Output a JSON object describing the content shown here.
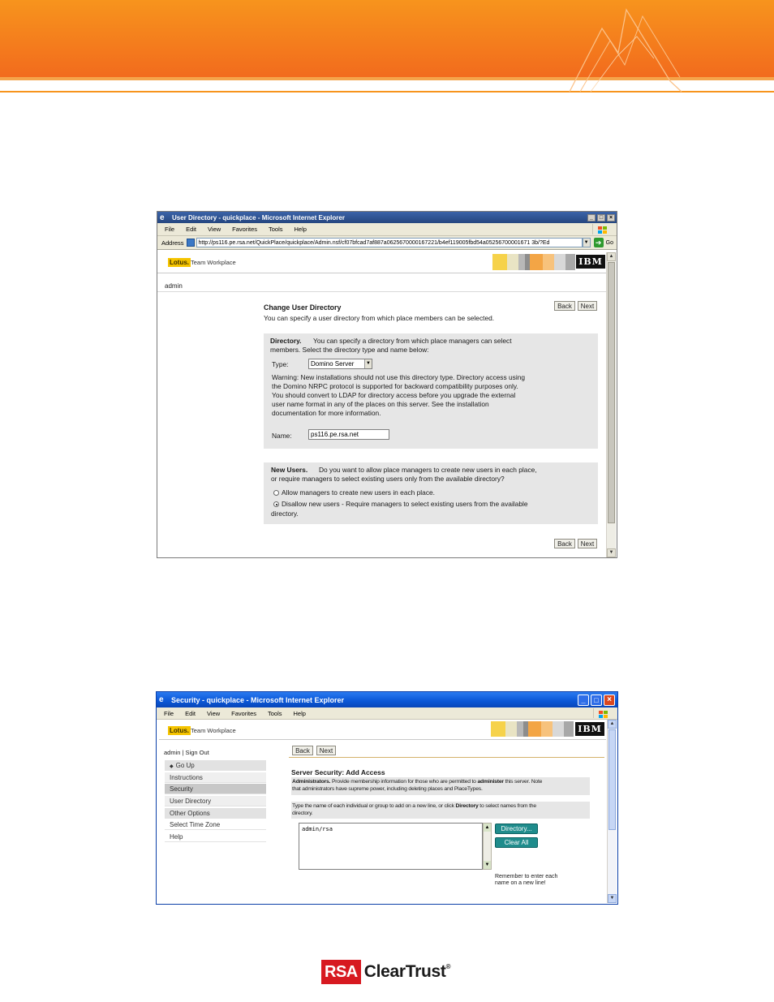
{
  "window1": {
    "title": "User Directory - quickplace - Microsoft Internet Explorer",
    "menu": [
      "File",
      "Edit",
      "View",
      "Favorites",
      "Tools",
      "Help"
    ],
    "address_label": "Address",
    "address_url": "http://ps116.pe.rsa.net/QuickPlace/quickplace/Admin.nsf/cf07bfcad7af887a0625670000167221/b4ef119005fbd54a05256700001671 3b/?Ed",
    "go_label": "Go",
    "lotus_label": "Lotus.",
    "product_label": "Team Workplace",
    "ibm_label": "IBM",
    "user": "admin",
    "heading": "Change User Directory",
    "subheading": "You can specify a user directory from which place members can be selected.",
    "back_label": "Back",
    "next_label": "Next",
    "directory": {
      "title": "Directory.",
      "desc_line1": "You can specify a directory from which place managers can select",
      "desc_line2": "members. Select the directory type and name below:",
      "type_label": "Type:",
      "type_value": "Domino Server",
      "warning_lines": [
        "Warning: New installations should not use this directory type. Directory access using",
        "the Domino NRPC protocol is supported for backward compatibility purposes only.",
        "You should convert to LDAP for directory access before you upgrade the external",
        "user name format in any of the places on this server. See the installation",
        "documentation for more information."
      ],
      "name_label": "Name:",
      "name_value": "ps116.pe.rsa.net"
    },
    "new_users": {
      "title": "New Users.",
      "desc_line1": "Do you want to allow place managers to create new users in each place,",
      "desc_line2": "or require managers to select existing users only from the available directory?",
      "option1": "Allow managers to create new users in each place.",
      "option2_line1": "Disallow new users - Require managers to select existing users from the available",
      "option2_line2": "directory."
    }
  },
  "window2": {
    "title": "Security - quickplace - Microsoft Internet Explorer",
    "menu": [
      "File",
      "Edit",
      "View",
      "Favorites",
      "Tools",
      "Help"
    ],
    "lotus_label": "Lotus.",
    "product_label": "Team Workplace",
    "ibm_label": "IBM",
    "user_line": "admin | Sign Out",
    "back_label": "Back",
    "next_label": "Next",
    "sidebar": [
      "Go Up",
      "Instructions",
      "Security",
      "User Directory",
      "Other Options",
      "Select Time Zone",
      "Help"
    ],
    "heading": "Server Security: Add Access",
    "admin_bold": "Administrators.",
    "admin_text1": "Provide membership information for those who are permitted to",
    "admin_bold2": "administer",
    "admin_text2": "this server. Note",
    "admin_line2": "that administrators have supreme power, including deleting places and PlaceTypes.",
    "type_names_line1a": "Type the name of each individual or group to add on a new line, or click",
    "type_names_bold": "Directory",
    "type_names_line1b": "to select names from the",
    "type_names_line2": "directory.",
    "textarea_value": "admin/rsa",
    "directory_btn": "Directory...",
    "clear_btn": "Clear All",
    "remember_line1": "Remember to enter each",
    "remember_line2": "name on a new line!"
  },
  "footer": {
    "rsa": "RSA",
    "product": "ClearTrust",
    "reg": "®"
  },
  "colors": {
    "banner_orange": "#f7941d",
    "xp_title_blue": "#0a5fd8",
    "classic_title_blue": "#2c4f8f",
    "rsa_red": "#d71920",
    "teal_button": "#1f8c8c"
  }
}
